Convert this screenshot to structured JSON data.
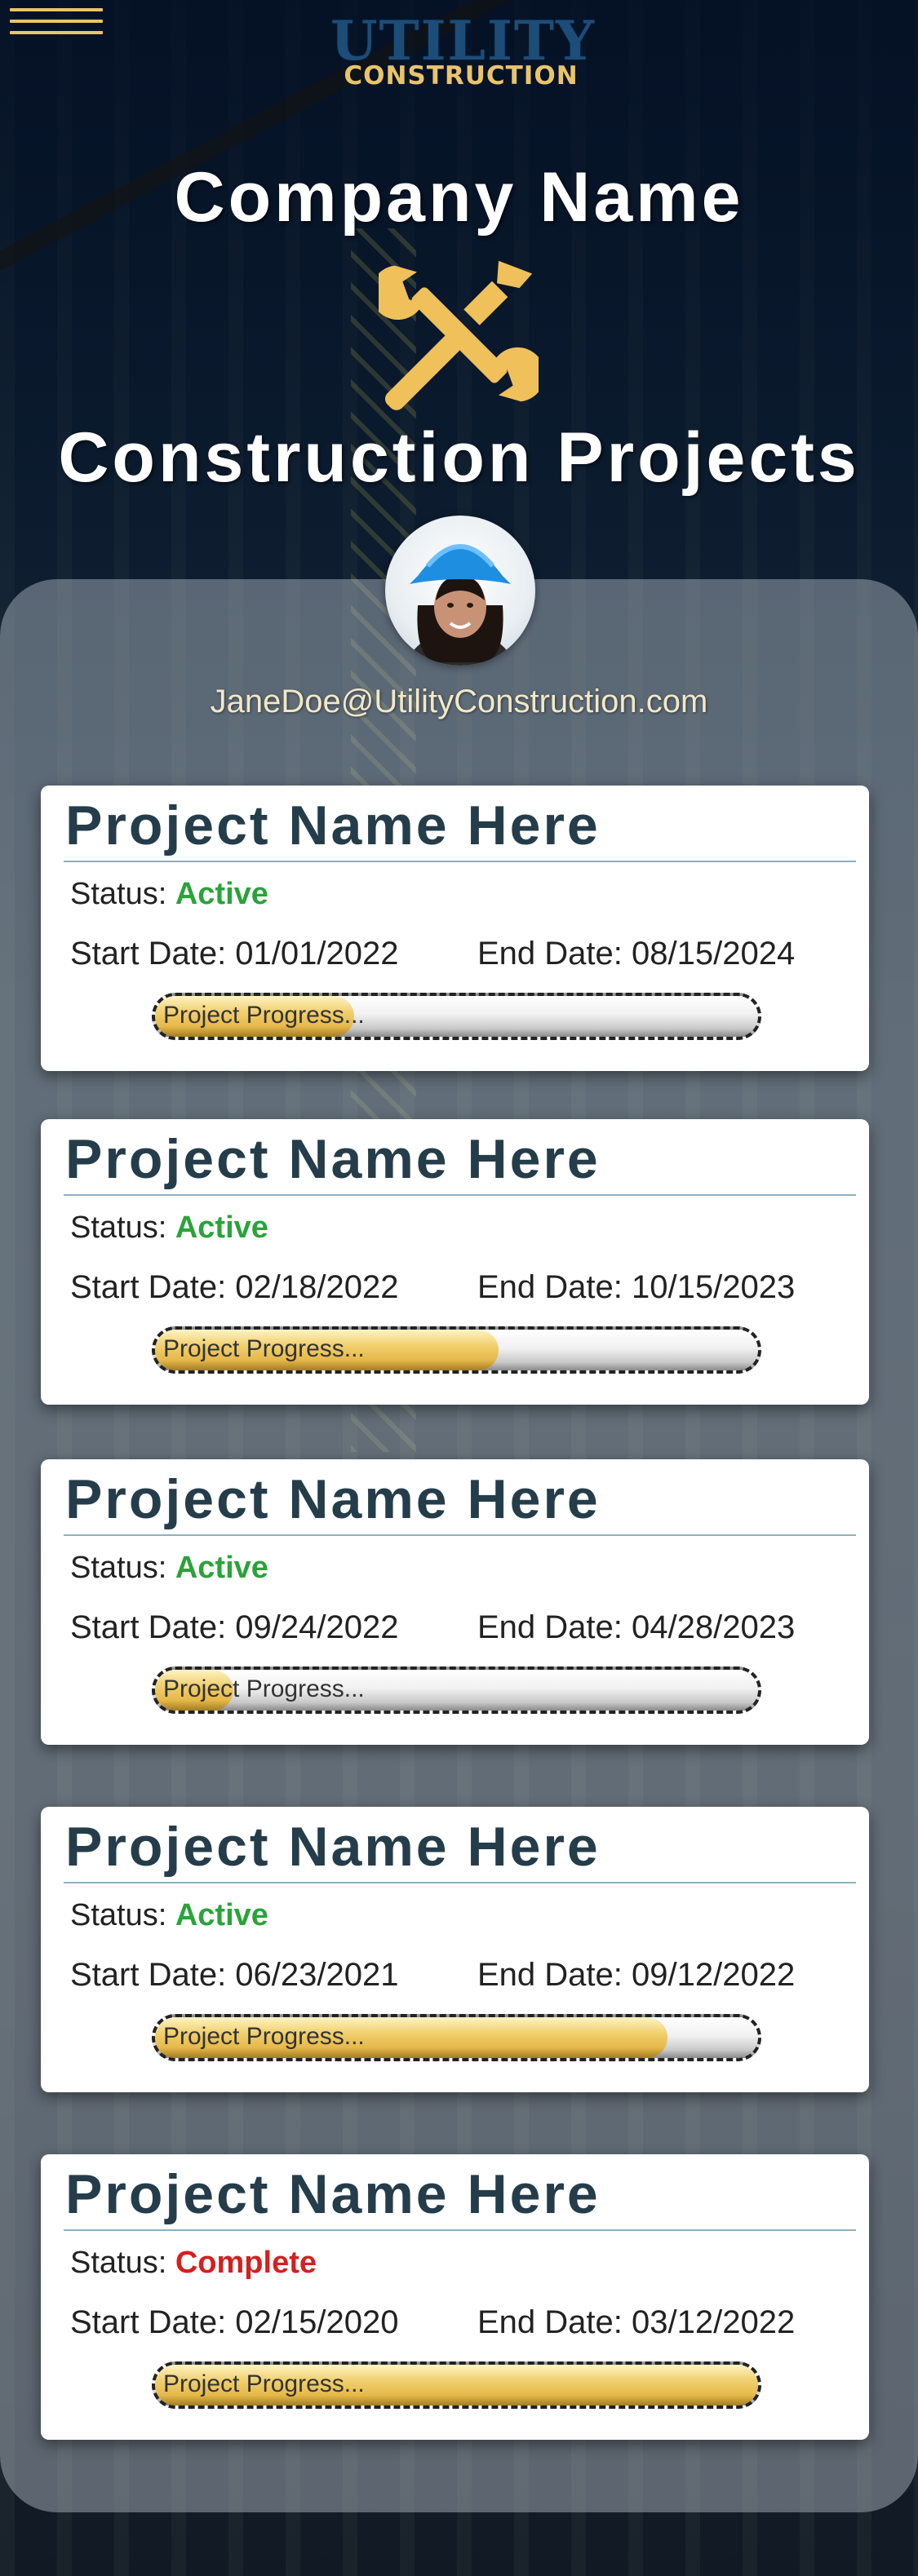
{
  "header": {
    "menu_icon": "hamburger-menu-icon",
    "logo_top": "UTILITY",
    "logo_bottom": "CONSTRUCTION",
    "company_name": "Company Name",
    "tools_icon": "wrench-screwdriver-icon",
    "title": "Construction Projects"
  },
  "profile": {
    "avatar": "profile-avatar",
    "email": "JaneDoe@UtilityConstruction.com"
  },
  "colors": {
    "accent": "#e9c46a",
    "active": "#2aa33a",
    "complete": "#d61f1f",
    "card_title": "#253d4a"
  },
  "projects": [
    {
      "name": "Project Name Here",
      "status_label": "Status:",
      "status": "Active",
      "start": "Start Date: 01/01/2022",
      "end": "End Date: 08/15/2024",
      "progress_label": "Project Progress...",
      "progress": 0.33
    },
    {
      "name": "Project Name Here",
      "status_label": "Status:",
      "status": "Active",
      "start": "Start Date: 02/18/2022",
      "end": "End Date: 10/15/2023",
      "progress_label": "Project Progress...",
      "progress": 0.57
    },
    {
      "name": "Project Name Here",
      "status_label": "Status:",
      "status": "Active",
      "start": "Start Date: 09/24/2022",
      "end": "End Date: 04/28/2023",
      "progress_label": "Project Progress...",
      "progress": 0.13
    },
    {
      "name": "Project Name Here",
      "status_label": "Status:",
      "status": "Active",
      "start": "Start Date: 06/23/2021",
      "end": "End Date: 09/12/2022",
      "progress_label": "Project Progress...",
      "progress": 0.85
    },
    {
      "name": "Project Name Here",
      "status_label": "Status:",
      "status": "Complete",
      "start": "Start Date: 02/15/2020",
      "end": "End Date: 03/12/2022",
      "progress_label": "Project Progress...",
      "progress": 1.0
    }
  ]
}
